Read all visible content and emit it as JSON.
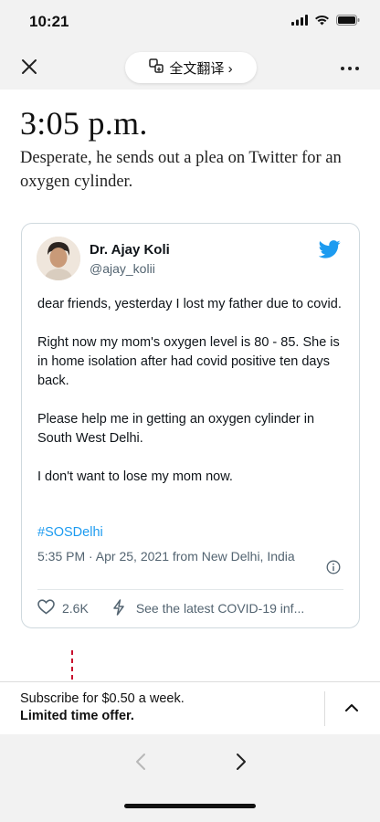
{
  "status_bar": {
    "time": "10:21"
  },
  "toolbar": {
    "translate_label": "全文翻译 ›",
    "close_icon": "close-icon",
    "more_icon": "more-icon"
  },
  "article": {
    "timestamp": "3:05 p.m.",
    "dek": "Desperate, he sends out a plea on Twitter for an oxygen cylinder."
  },
  "tweet": {
    "author_name": "Dr. Ajay Koli",
    "handle": "@ajay_kolii",
    "paragraphs": [
      "dear friends, yesterday I lost my father due to covid.",
      "Right now my mom's oxygen level is 80 - 85. She is in home isolation after had covid positive ten days back.",
      "Please help me in getting an oxygen cylinder in South West Delhi.",
      "I don't want to lose my mom now."
    ],
    "hashtag": "#SOSDelhi",
    "meta": "5:35 PM · Apr 25, 2021 from New Delhi, India",
    "likes": "2.6K",
    "action_link": "See the latest COVID-19 inf..."
  },
  "subscribe": {
    "line1": "Subscribe for $0.50 a week.",
    "line2": "Limited time offer."
  },
  "colors": {
    "accent_blue": "#1d9bf0",
    "timeline_red": "#c8102e",
    "chrome_gray": "#f2f2f2"
  }
}
